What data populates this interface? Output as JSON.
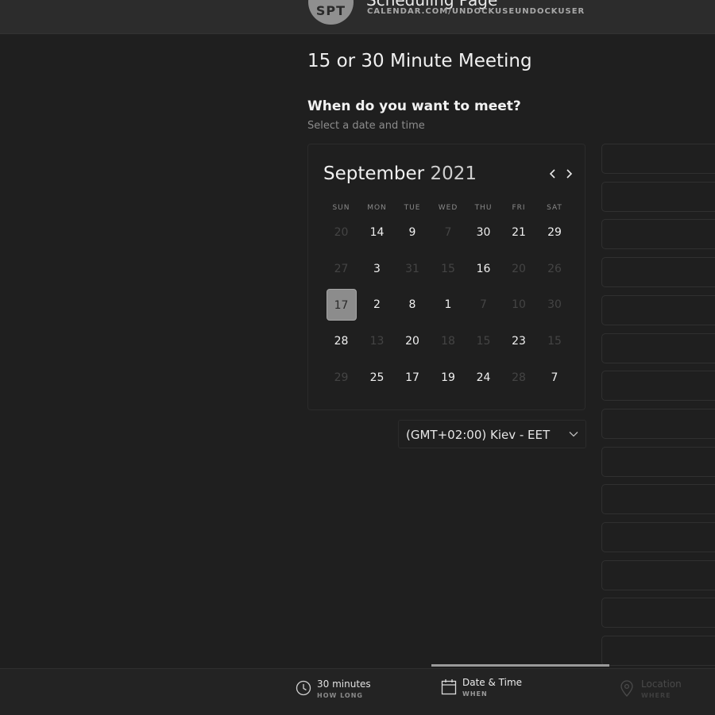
{
  "header": {
    "avatar_initials": "SPT",
    "name": "Scheduling Page",
    "url": "CALENDAR.COM/UNDOCKUSEUNDOCKUSER"
  },
  "main": {
    "title": "15 or 30 Minute Meeting",
    "question": "When do you want to meet?",
    "subtitle": "Select a date and time"
  },
  "calendar": {
    "month": "September",
    "year": "2021",
    "weekdays": [
      "SUN",
      "MON",
      "TUE",
      "WED",
      "THU",
      "FRI",
      "SAT"
    ],
    "weeks": [
      [
        {
          "d": "20",
          "active": false
        },
        {
          "d": "14",
          "active": true
        },
        {
          "d": "9",
          "active": true
        },
        {
          "d": "7",
          "active": false
        },
        {
          "d": "30",
          "active": true
        },
        {
          "d": "21",
          "active": true
        },
        {
          "d": "29",
          "active": true
        }
      ],
      [
        {
          "d": "27",
          "active": false
        },
        {
          "d": "3",
          "active": true
        },
        {
          "d": "31",
          "active": false
        },
        {
          "d": "15",
          "active": false
        },
        {
          "d": "16",
          "active": true
        },
        {
          "d": "20",
          "active": false
        },
        {
          "d": "26",
          "active": false
        }
      ],
      [
        {
          "d": "17",
          "active": true,
          "selected": true
        },
        {
          "d": "2",
          "active": true
        },
        {
          "d": "8",
          "active": true
        },
        {
          "d": "1",
          "active": true
        },
        {
          "d": "7",
          "active": false
        },
        {
          "d": "10",
          "active": false
        },
        {
          "d": "30",
          "active": false
        }
      ],
      [
        {
          "d": "28",
          "active": true
        },
        {
          "d": "13",
          "active": false
        },
        {
          "d": "20",
          "active": true
        },
        {
          "d": "18",
          "active": false
        },
        {
          "d": "15",
          "active": false
        },
        {
          "d": "23",
          "active": true
        },
        {
          "d": "15",
          "active": false
        }
      ],
      [
        {
          "d": "29",
          "active": false
        },
        {
          "d": "25",
          "active": true
        },
        {
          "d": "17",
          "active": true
        },
        {
          "d": "19",
          "active": true
        },
        {
          "d": "24",
          "active": true
        },
        {
          "d": "28",
          "active": false
        },
        {
          "d": "7",
          "active": true
        }
      ]
    ]
  },
  "timezone": {
    "label": "(GMT+02:00) Kiev - EET"
  },
  "time_slots": [
    "",
    "",
    "",
    "",
    "",
    "",
    "",
    "",
    "",
    "",
    "",
    "",
    "",
    ""
  ],
  "steps": [
    {
      "label": "30 minutes",
      "sub": "HOW LONG",
      "icon": "clock-icon",
      "state": "done"
    },
    {
      "label": "Date & Time",
      "sub": "WHEN",
      "icon": "calendar-icon",
      "state": "current"
    },
    {
      "label": "Location",
      "sub": "WHERE",
      "icon": "location-pin-icon",
      "state": "upcoming"
    }
  ],
  "colors": {
    "background": "#1f1f1f",
    "selected_day": "#8c8c8c",
    "progress": "#9a9a9a"
  }
}
